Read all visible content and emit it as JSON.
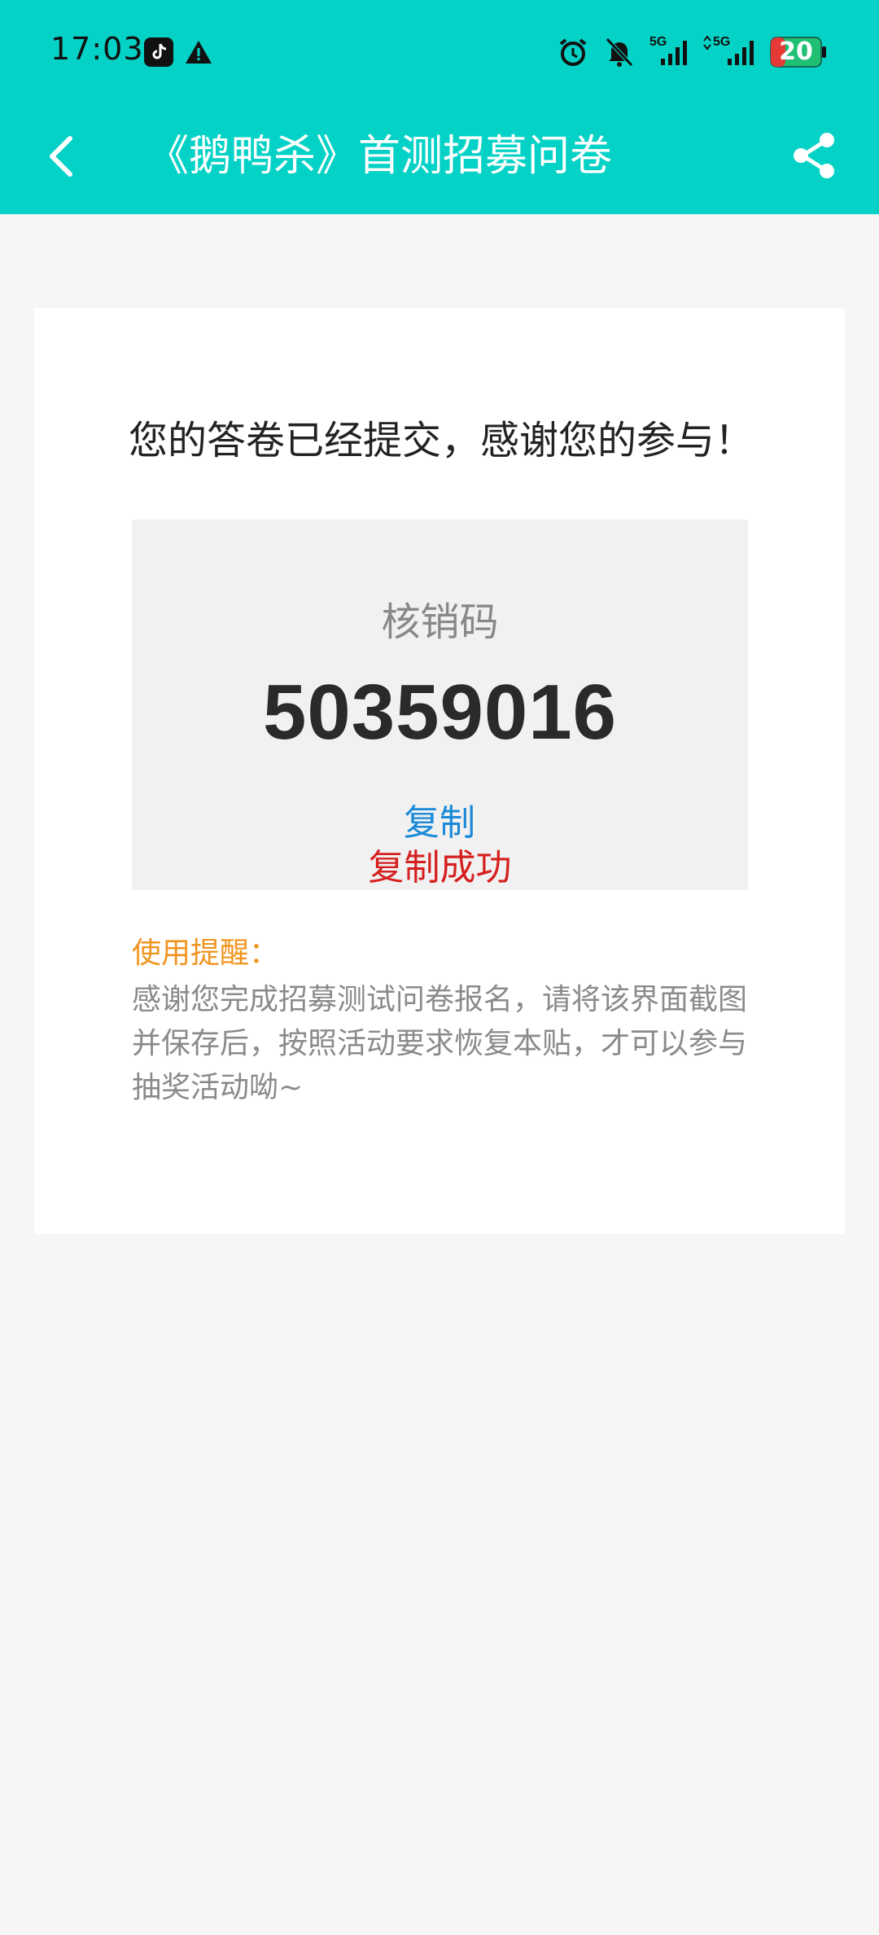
{
  "status_bar": {
    "time": "17:03",
    "battery_level": "20",
    "icons": [
      "tiktok-icon",
      "warning-icon",
      "alarm-icon",
      "bell-off-icon",
      "signal-5g-icon",
      "signal-5g-icon",
      "battery-icon"
    ],
    "signal_labels": [
      "5G",
      "5G"
    ]
  },
  "header": {
    "title": "《鹅鸭杀》首测招募问卷",
    "background_color": "#05d2c6"
  },
  "card": {
    "submit_message": "您的答卷已经提交，感谢您的参与！",
    "code_label": "核销码",
    "code_value": "50359016",
    "copy_label": "复制",
    "copy_success": "复制成功",
    "reminder_title": "使用提醒：",
    "reminder_text": "感谢您完成招募测试问卷报名，请将该界面截图并保存后，按照活动要求恢复本贴，才可以参与抽奖活动呦~"
  },
  "colors": {
    "accent": "#05d2c6",
    "link": "#1a8ad8",
    "success": "#d61f1f",
    "reminder": "#f0941e"
  }
}
